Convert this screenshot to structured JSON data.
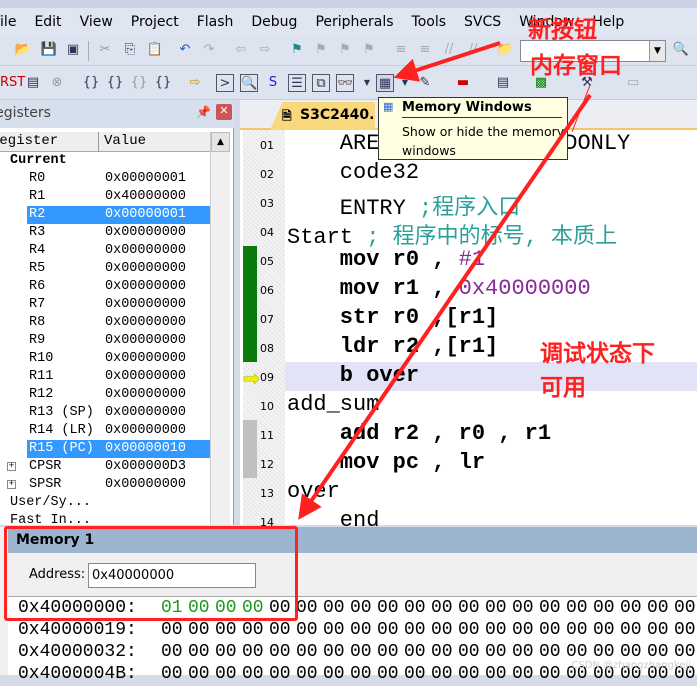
{
  "menu": [
    "File",
    "Edit",
    "View",
    "Project",
    "Flash",
    "Debug",
    "Peripherals",
    "Tools",
    "SVCS",
    "Window",
    "Help"
  ],
  "registers": {
    "panel_title": "Registers",
    "col_register": "Register",
    "col_value": "Value",
    "group": "Current",
    "rows": [
      {
        "name": "R0",
        "value": "0x00000001"
      },
      {
        "name": "R1",
        "value": "0x40000000"
      },
      {
        "name": "R2",
        "value": "0x00000001",
        "selected": true
      },
      {
        "name": "R3",
        "value": "0x00000000"
      },
      {
        "name": "R4",
        "value": "0x00000000"
      },
      {
        "name": "R5",
        "value": "0x00000000"
      },
      {
        "name": "R6",
        "value": "0x00000000"
      },
      {
        "name": "R7",
        "value": "0x00000000"
      },
      {
        "name": "R8",
        "value": "0x00000000"
      },
      {
        "name": "R9",
        "value": "0x00000000"
      },
      {
        "name": "R10",
        "value": "0x00000000"
      },
      {
        "name": "R11",
        "value": "0x00000000"
      },
      {
        "name": "R12",
        "value": "0x00000000"
      },
      {
        "name": "R13 (SP)",
        "value": "0x00000000"
      },
      {
        "name": "R14 (LR)",
        "value": "0x00000000"
      },
      {
        "name": "R15 (PC)",
        "value": "0x00000010",
        "selected": true
      },
      {
        "name": "CPSR",
        "value": "0x000000D3"
      },
      {
        "name": "SPSR",
        "value": "0x00000000"
      }
    ],
    "user_sys": "User/Sy...",
    "fast_int": "Fast In..."
  },
  "editor": {
    "tab": "S3C2440.s",
    "lines": [
      {
        "n": "01",
        "code": "    AREA ... CODE,READONLY"
      },
      {
        "n": "02",
        "code": "    code32"
      },
      {
        "n": "03",
        "code": "    ENTRY ",
        "comment": ";程序入口"
      },
      {
        "n": "04",
        "code": "Start ",
        "comment": "; 程序中的标号, 本质上"
      },
      {
        "n": "05",
        "code": "    mov r0 , ",
        "num": "#1"
      },
      {
        "n": "06",
        "code": "    mov r1 , ",
        "num": "0x40000000"
      },
      {
        "n": "07",
        "code": "    str r0 ,[r1]"
      },
      {
        "n": "08",
        "code": "    ldr r2 ,[r1]"
      },
      {
        "n": "09",
        "code": "    b over"
      },
      {
        "n": "10",
        "code": "add_sum"
      },
      {
        "n": "11",
        "code": "    add r2 , r0 , r1"
      },
      {
        "n": "12",
        "code": "    mov pc , lr"
      },
      {
        "n": "13",
        "code": "over"
      },
      {
        "n": "14",
        "code": "    end"
      }
    ]
  },
  "tooltip": {
    "title": "Memory Windows",
    "body": "Show or hide the memory windows"
  },
  "memory": {
    "title": "Memory 1",
    "address_label": "Address:",
    "address_value": "0x40000000",
    "rows": [
      {
        "addr": "0x40000000:",
        "bytes": [
          "01",
          "00",
          "00",
          "00",
          "00",
          "00",
          "00",
          "00",
          "00",
          "00",
          "00",
          "00",
          "00",
          "00",
          "00",
          "00",
          "00",
          "00",
          "00",
          "00",
          "00"
        ]
      },
      {
        "addr": "0x40000019:",
        "bytes": [
          "00",
          "00",
          "00",
          "00",
          "00",
          "00",
          "00",
          "00",
          "00",
          "00",
          "00",
          "00",
          "00",
          "00",
          "00",
          "00",
          "00",
          "00",
          "00",
          "00",
          "00"
        ]
      },
      {
        "addr": "0x40000032:",
        "bytes": [
          "00",
          "00",
          "00",
          "00",
          "00",
          "00",
          "00",
          "00",
          "00",
          "00",
          "00",
          "00",
          "00",
          "00",
          "00",
          "00",
          "00",
          "00",
          "00",
          "00",
          "00"
        ]
      },
      {
        "addr": "0x4000004B:",
        "bytes": [
          "00",
          "00",
          "00",
          "00",
          "00",
          "00",
          "00",
          "00",
          "00",
          "00",
          "00",
          "00",
          "00",
          "00",
          "00",
          "00",
          "00",
          "00",
          "00",
          "00",
          "00"
        ]
      }
    ],
    "changed_color": "#1a9a1a"
  },
  "annotations": {
    "new_button": "新按钮",
    "memory_window": "内存窗口",
    "debug_only_1": "调试状态下",
    "debug_only_2": "可用",
    "color": "#ff2020"
  },
  "watermark": "CSDN @zhangzhangkeji"
}
